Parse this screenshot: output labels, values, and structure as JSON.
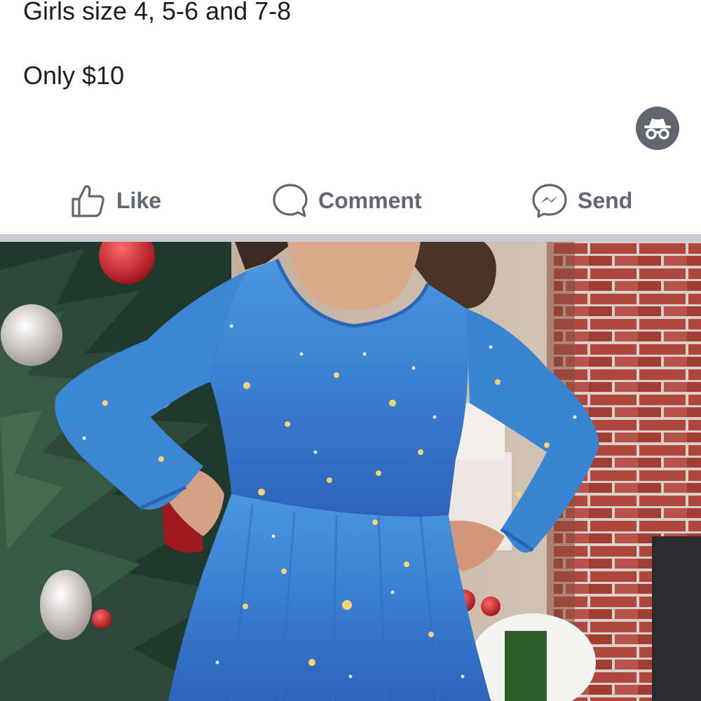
{
  "post": {
    "text_lines": [
      "Girls size 4, 5-6 and 7-8",
      "Only $10"
    ]
  },
  "icons": {
    "incognito": "incognito-icon",
    "like": "thumbs-up-icon",
    "comment": "speech-bubble-icon",
    "send": "messenger-icon",
    "incognito_bg": "#606770"
  },
  "actions": {
    "like_label": "Like",
    "comment_label": "Comment",
    "send_label": "Send",
    "label_color": "#606770"
  },
  "photo": {
    "subject": "girl-in-blue-star-print-dress",
    "dress_color": "#3a7fd0",
    "background_left": "christmas-tree",
    "background_right": "brick-fireplace"
  }
}
